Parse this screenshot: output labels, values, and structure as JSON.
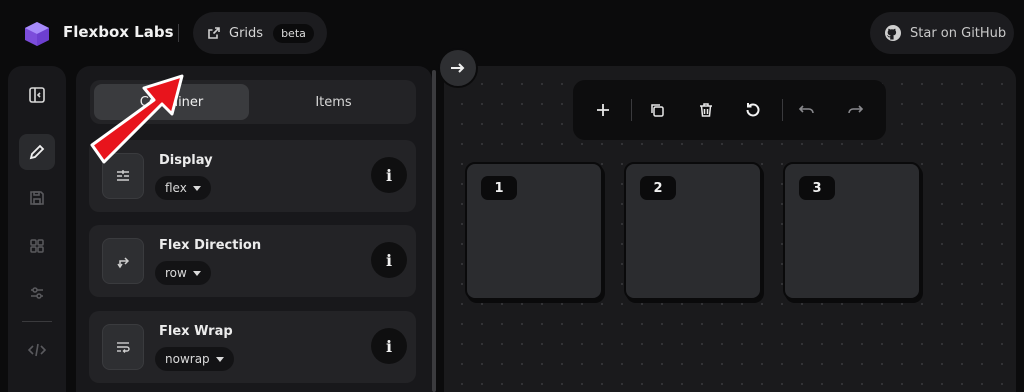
{
  "header": {
    "brand": "Flexbox Labs",
    "grids_label": "Grids",
    "beta_label": "beta",
    "github_label": "Star on GitHub",
    "accent_color": "#8b5cf6"
  },
  "rail": {
    "items": [
      {
        "name": "sidebar-toggle-icon",
        "active": false
      },
      {
        "name": "edit-pencil-icon",
        "active": true
      },
      {
        "name": "save-icon",
        "active": false
      },
      {
        "name": "grid-layout-icon",
        "active": false
      },
      {
        "name": "sliders-icon",
        "active": false
      },
      {
        "name": "code-icon",
        "active": false
      }
    ]
  },
  "panel": {
    "tabs": [
      {
        "label": "Container",
        "active": true
      },
      {
        "label": "Items",
        "active": false
      }
    ],
    "properties": [
      {
        "label": "Display",
        "value": "flex",
        "icon": "display-icon"
      },
      {
        "label": "Flex Direction",
        "value": "row",
        "icon": "flex-direction-icon"
      },
      {
        "label": "Flex Wrap",
        "value": "nowrap",
        "icon": "flex-wrap-icon"
      }
    ],
    "info_glyph": "i"
  },
  "toolbar": {
    "buttons": [
      "add-icon",
      "duplicate-icon",
      "delete-icon",
      "reset-icon",
      "undo-icon",
      "redo-icon"
    ]
  },
  "canvas": {
    "items": [
      "1",
      "2",
      "3"
    ]
  },
  "annotation": {
    "arrow_color": "#e8141c"
  }
}
